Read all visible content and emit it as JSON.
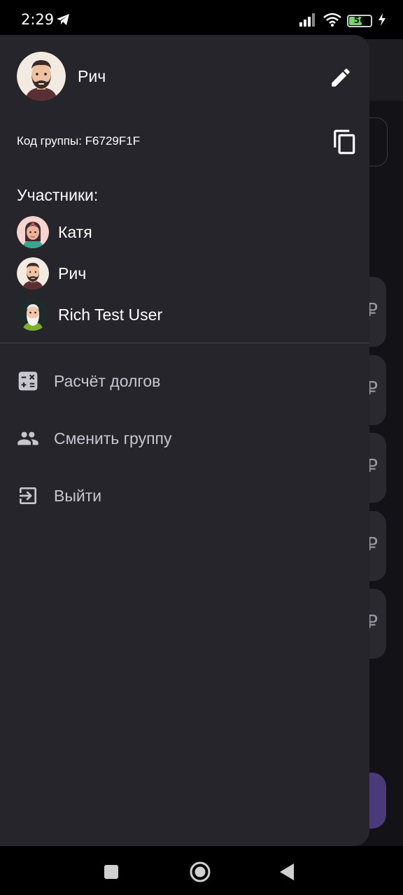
{
  "status_bar": {
    "time": "2:29",
    "battery_level": "56",
    "icons": [
      "telegram-icon",
      "signal-icon",
      "wifi-icon",
      "battery-icon",
      "charging-icon"
    ]
  },
  "drawer": {
    "profile": {
      "name": "Рич",
      "avatar": "bearded-man-avatar"
    },
    "group_code": "Код группы: F6729F1F",
    "members_title": "Участники:",
    "members": [
      {
        "name": "Катя",
        "avatar": "woman-avatar"
      },
      {
        "name": "Рич",
        "avatar": "bearded-man-avatar"
      },
      {
        "name": "Rich Test User",
        "avatar": "old-man-avatar"
      }
    ],
    "menu": [
      {
        "label": "Расчёт долгов",
        "icon": "calculator-icon"
      },
      {
        "label": "Сменить группу",
        "icon": "group-icon"
      },
      {
        "label": "Выйти",
        "icon": "exit-icon"
      }
    ]
  },
  "background": {
    "currency_symbol": "₽"
  },
  "colors": {
    "drawer_bg": "#26252b",
    "app_bg": "#131216",
    "accent": "#4a3a7a",
    "text_primary": "#ffffff",
    "text_menu": "#c8c6cf"
  }
}
